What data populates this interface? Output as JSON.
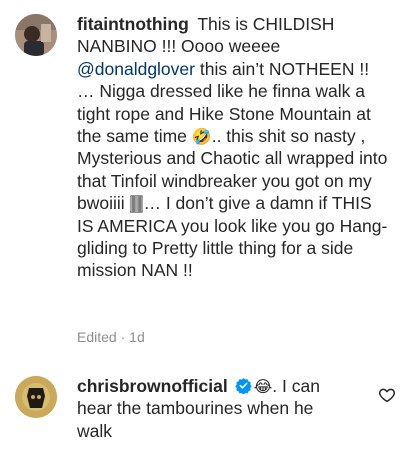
{
  "comments": [
    {
      "username": "fitaintnothing",
      "text_before_mention": "This is CHILDISH NANBINO !!! Oooo weeee ",
      "mention": "@donaldglover",
      "text_after_mention": " this ain’t NOTHEEN !! … Nigga dressed like he finna walk a tight rope and Hike Stone Mountain at the same time ",
      "emoji_1": "🤣",
      "text_after_emoji_1": ".. this shit so nasty , Mysterious and Chaotic all wrapped into that Tinfoil windbreaker you got on my bwoiiii ",
      "emoji_2": "🀫",
      "text_after_emoji_2": "… I don’t give a damn if THIS IS AMERICA you look like you go Hang-gliding to Pretty little thing for a side mission NAN !!",
      "edited": "Edited",
      "separator": "·",
      "time": "1d"
    },
    {
      "username": "chrisbrownofficial",
      "emoji": "😂",
      "text": ". I can hear the tambourines when he walk"
    }
  ],
  "colors": {
    "text": "#262626",
    "mention": "#00376b",
    "meta": "#8e8e8e",
    "verified": "#0095f6"
  },
  "icons": {
    "verified": "verified-badge-icon",
    "like": "heart-outline-icon"
  }
}
